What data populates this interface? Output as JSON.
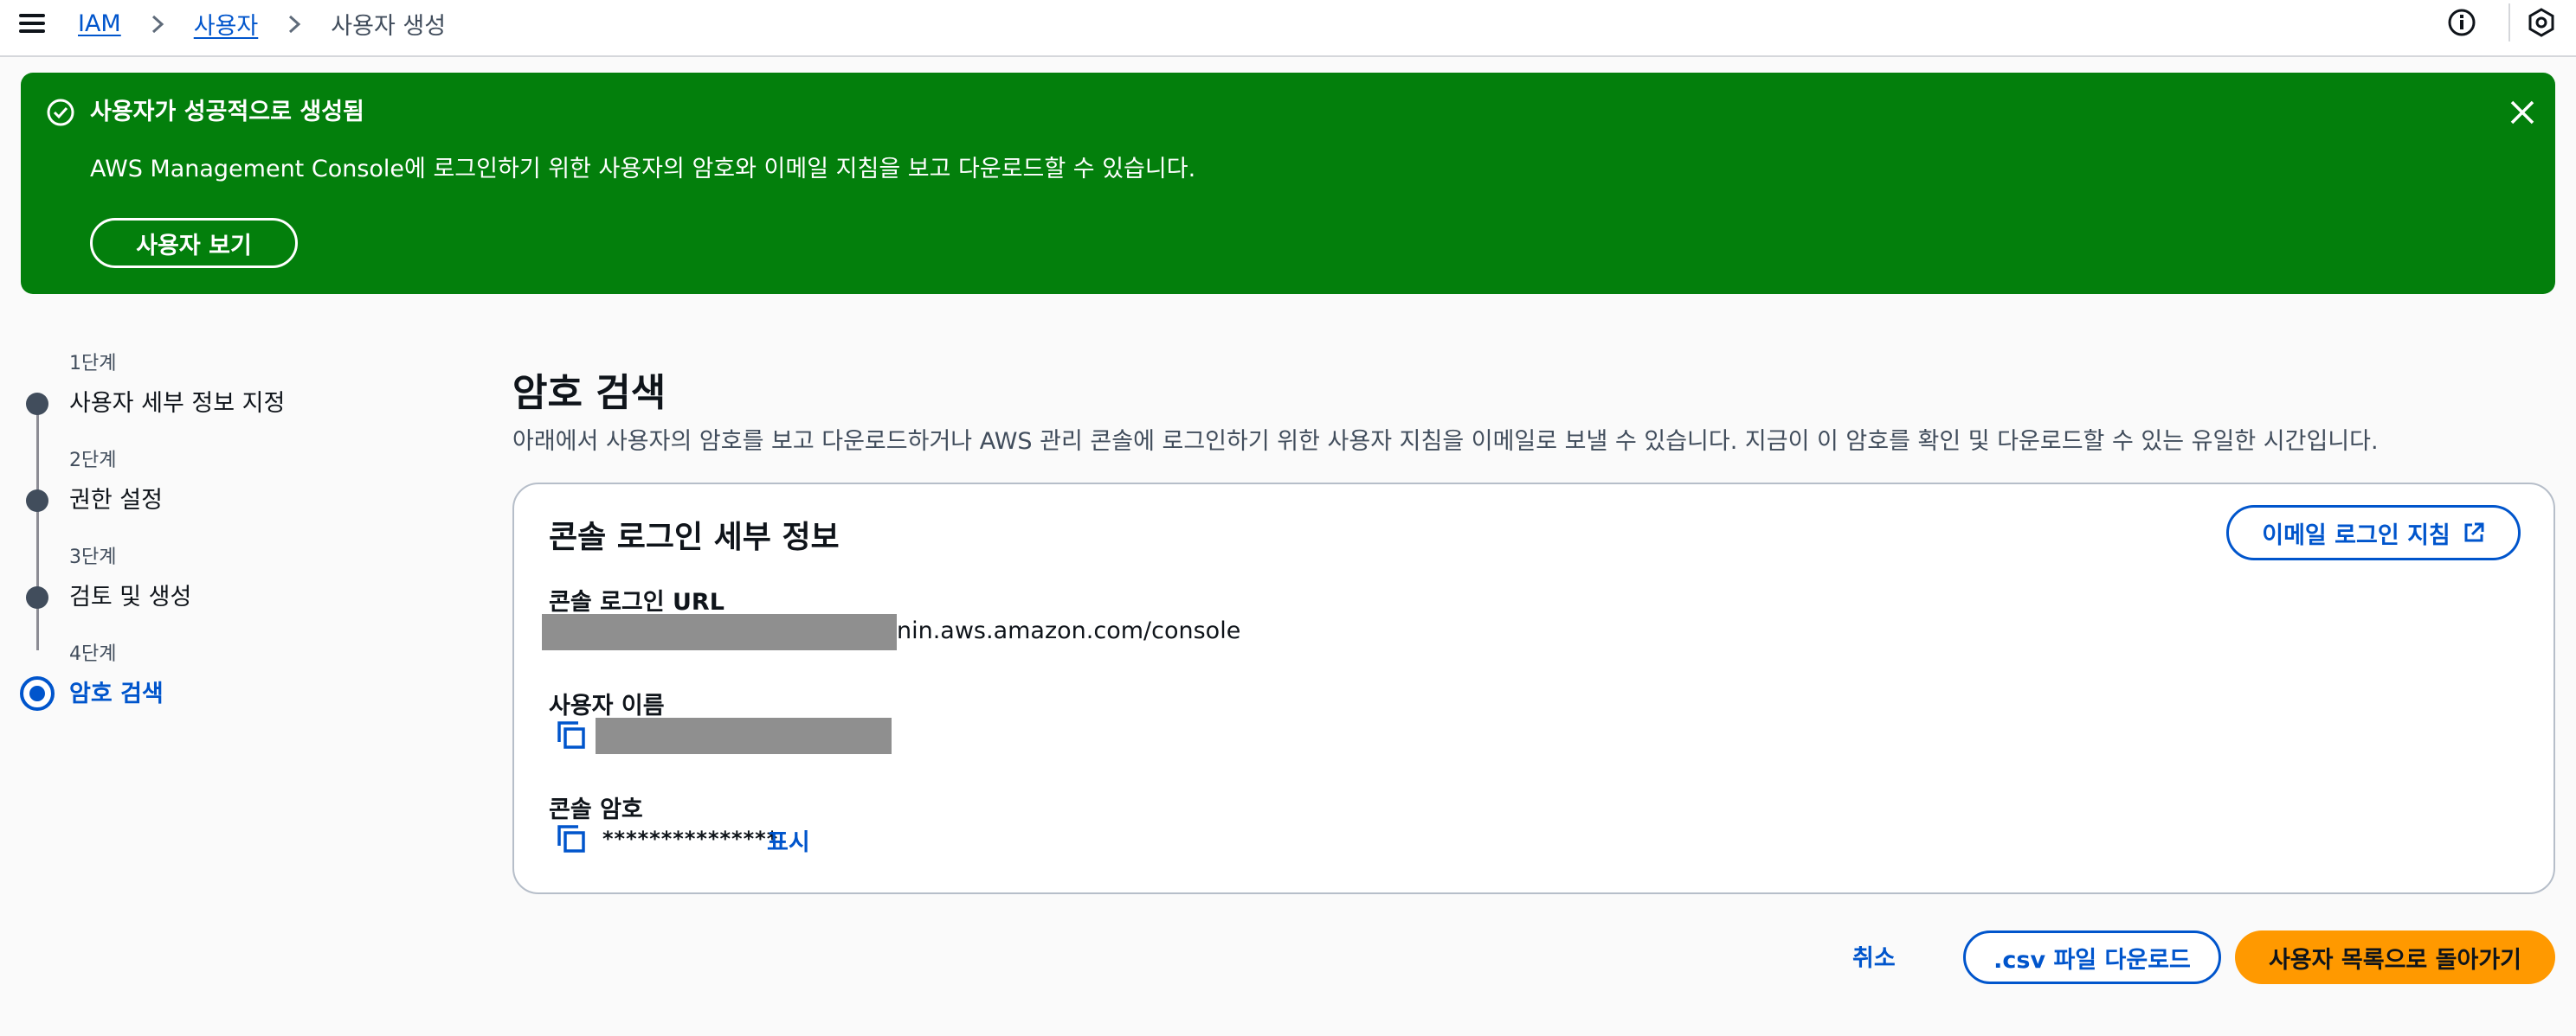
{
  "breadcrumb": {
    "items": [
      {
        "label": "IAM"
      },
      {
        "label": "사용자"
      },
      {
        "label": "사용자 생성"
      }
    ]
  },
  "flash": {
    "title": "사용자가 성공적으로 생성됨",
    "message": "AWS Management Console에 로그인하기 위한 사용자의 암호와 이메일 지침을 보고 다운로드할 수 있습니다.",
    "button_label": "사용자 보기",
    "color": "#037f0c"
  },
  "steps": [
    {
      "number": "1단계",
      "label": "사용자 세부 정보 지정"
    },
    {
      "number": "2단계",
      "label": "권한 설정"
    },
    {
      "number": "3단계",
      "label": "검토 및 생성"
    },
    {
      "number": "4단계",
      "label": "암호 검색",
      "active": true
    }
  ],
  "main": {
    "title": "암호 검색",
    "description": "아래에서 사용자의 암호를 보고 다운로드하거나 AWS 관리 콘솔에 로그인하기 위한 사용자 지침을 이메일로 보낼 수 있습니다. 지금이 이 암호를 확인 및 다운로드할 수 있는 유일한 시간입니다."
  },
  "card": {
    "title": "콘솔 로그인 세부 정보",
    "email_button": "이메일 로그인 지침",
    "url_label": "콘솔 로그인 URL",
    "url_suffix": "nin.aws.amazon.com/console",
    "username_label": "사용자 이름",
    "password_label": "콘솔 암호",
    "password_mask": "***************",
    "show_label": "표시"
  },
  "footer": {
    "cancel": "취소",
    "download_csv": ".csv 파일 다운로드",
    "return": "사용자 목록으로 돌아가기"
  },
  "colors": {
    "link": "#0055cc",
    "primary": "#ff9900",
    "success": "#037f0c"
  }
}
